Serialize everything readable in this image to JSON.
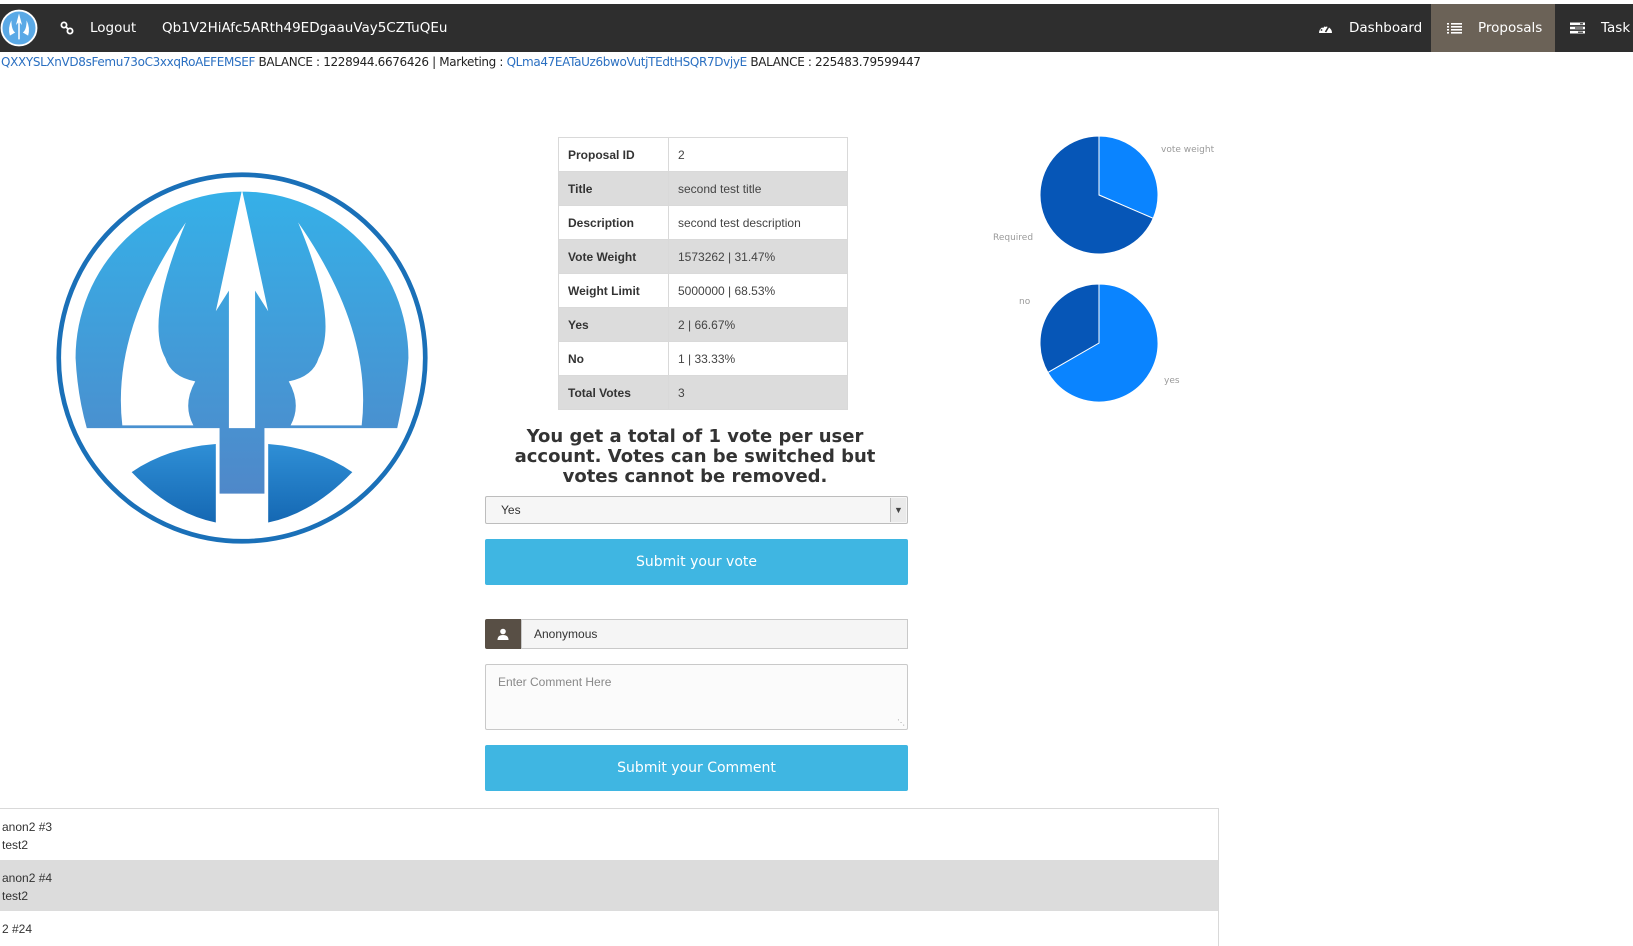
{
  "nav": {
    "logout": "Logout",
    "account": "Qb1V2HiAfc5ARth49EDgaauVay5CZTuQEu",
    "dashboard": "Dashboard",
    "proposals": "Proposals",
    "task": "Task I"
  },
  "balances": {
    "main_address": "QXXYSLXnVD8sFemu73oC3xxqRoAEFEMSEF",
    "main_balance": " BALANCE : 1228944.6676426 | Marketing : ",
    "marketing_address": "QLma47EATaUz6bwoVutjTEdtHSQR7DvjyE",
    "marketing_balance": " BALANCE : 225483.79599447"
  },
  "proposal": {
    "rows": [
      {
        "key": "Proposal ID",
        "value": "2"
      },
      {
        "key": "Title",
        "value": "second test title"
      },
      {
        "key": "Description",
        "value": "second test description"
      },
      {
        "key": "Vote Weight",
        "value": "1573262 | 31.47%"
      },
      {
        "key": "Weight Limit",
        "value": "5000000 | 68.53%"
      },
      {
        "key": "Yes",
        "value": "2 | 66.67%"
      },
      {
        "key": "No",
        "value": "1 | 33.33%"
      },
      {
        "key": "Total Votes",
        "value": "3"
      }
    ]
  },
  "chart_data": [
    {
      "type": "pie",
      "labels": [
        "vote weight",
        "Required"
      ],
      "values": [
        31.47,
        68.53
      ],
      "colors": [
        "#0a84ff",
        "#0656b7"
      ]
    },
    {
      "type": "pie",
      "labels": [
        "yes",
        "no"
      ],
      "values": [
        66.67,
        33.33
      ],
      "colors": [
        "#0a84ff",
        "#0656b7"
      ]
    }
  ],
  "vote": {
    "notice": "You get a total of 1 vote per user account. Votes can be switched but votes cannot be removed.",
    "selected": "Yes",
    "submit_label": "Submit your vote"
  },
  "comment_form": {
    "name": "Anonymous",
    "placeholder": "Enter Comment Here",
    "submit_label": "Submit your Comment"
  },
  "comments": [
    {
      "author": "anon2 #3",
      "text": "test2"
    },
    {
      "author": "anon2 #4",
      "text": "test2"
    },
    {
      "author": "2 #24",
      "text": ""
    }
  ],
  "icons": {
    "logout": "link-icon",
    "dashboard": "dashboard-gauge-icon",
    "proposals": "list-icon",
    "task": "tasks-icon",
    "user": "user-icon",
    "brand": "trident-logo"
  }
}
